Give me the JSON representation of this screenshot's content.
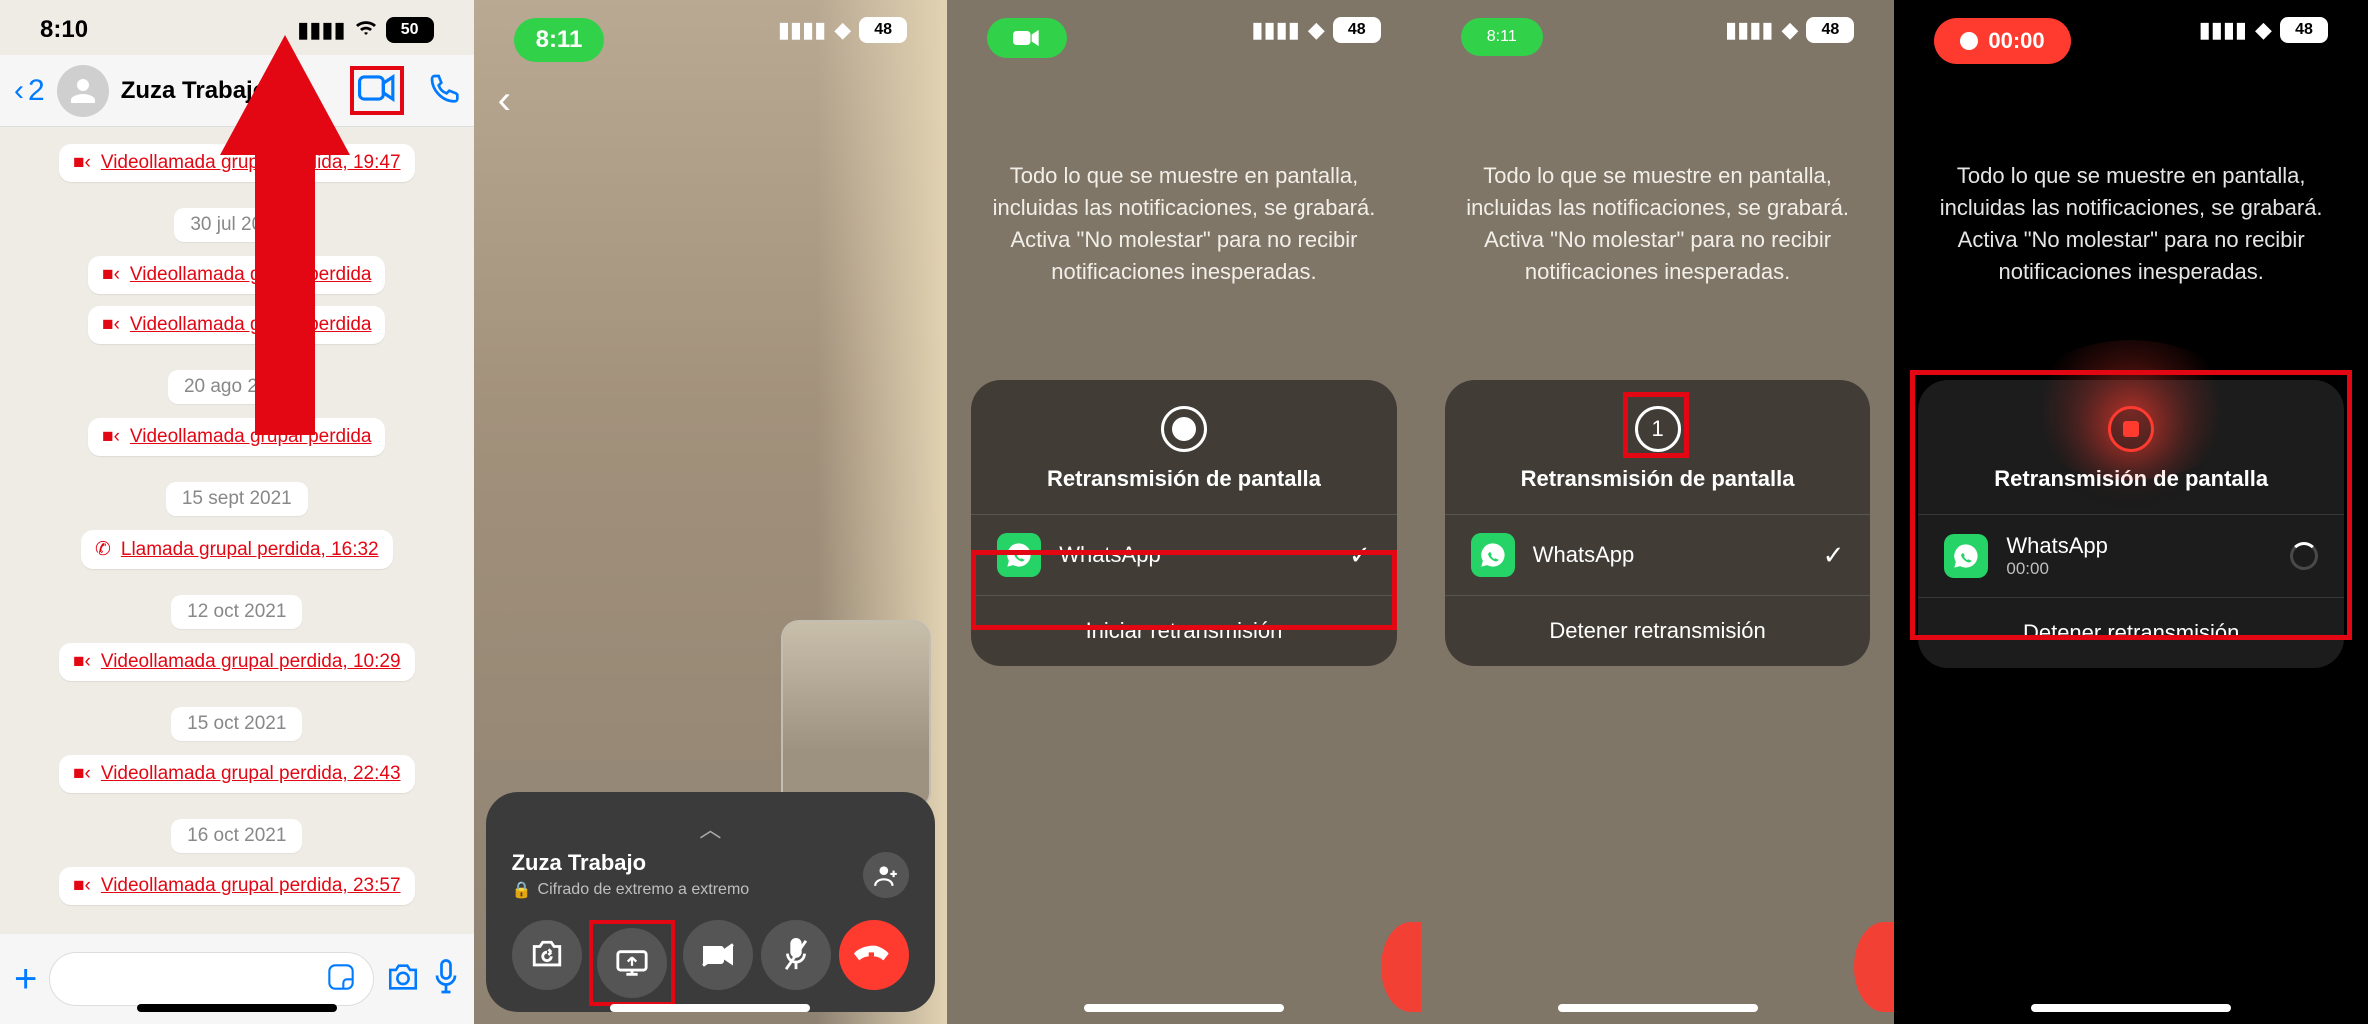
{
  "p1": {
    "time": "8:10",
    "battery": "50",
    "back_count": "2",
    "contact_name": "Zuza Trabajo",
    "timeline": [
      {
        "type": "call",
        "label": "Videollamada grupal perdida, 19:47"
      },
      {
        "type": "date",
        "label": "30 jul 2021"
      },
      {
        "type": "call",
        "label": "Videollamada grupal perdida"
      },
      {
        "type": "call",
        "label": "Videollamada grupal perdida"
      },
      {
        "type": "date",
        "label": "20 ago 2021"
      },
      {
        "type": "call",
        "label": "Videollamada grupal perdida"
      },
      {
        "type": "date",
        "label": "15 sept 2021"
      },
      {
        "type": "audio",
        "label": "Llamada grupal perdida, 16:32"
      },
      {
        "type": "date",
        "label": "12 oct 2021"
      },
      {
        "type": "call",
        "label": "Videollamada grupal perdida, 10:29"
      },
      {
        "type": "date",
        "label": "15 oct 2021"
      },
      {
        "type": "call",
        "label": "Videollamada grupal perdida, 22:43"
      },
      {
        "type": "date",
        "label": "16 oct 2021"
      },
      {
        "type": "call",
        "label": "Videollamada grupal perdida, 23:57"
      }
    ]
  },
  "p2": {
    "pill_time": "8:11",
    "battery": "48",
    "contact_name": "Zuza Trabajo",
    "encryption": "Cifrado de extremo a extremo"
  },
  "broadcast_msg": "Todo lo que se muestre en pantalla, incluidas las notificaciones, se grabará. Activa \"No molestar\" para no recibir notificaciones inesperadas.",
  "sheet": {
    "title": "Retransmisión de pantalla",
    "app_name": "WhatsApp",
    "start": "Iniciar retransmisión",
    "stop": "Detener retransmisión",
    "countdown": "1",
    "elapsed": "00:00"
  },
  "p3": {
    "battery": "48"
  },
  "p4": {
    "pill_time": "8:11",
    "battery": "48"
  },
  "p5": {
    "pill_time": "00:00",
    "battery": "48"
  }
}
